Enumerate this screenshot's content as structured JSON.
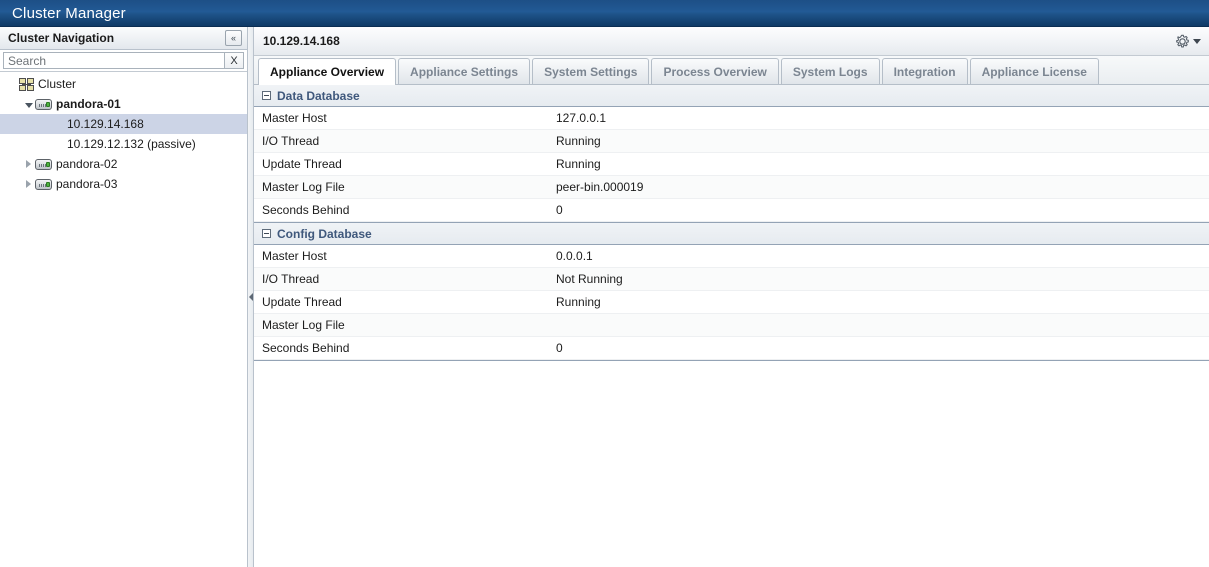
{
  "app": {
    "title": "Cluster Manager",
    "titlebar_color": "#1e5288"
  },
  "sidebar": {
    "header_title": "Cluster Navigation",
    "collapse_icon": "double-chevron-left-icon",
    "collapse_label": "«",
    "search": {
      "placeholder": "Search",
      "value": "",
      "clear_label": "X"
    },
    "tree": [
      {
        "label": "Cluster",
        "icon": "cluster-icon",
        "indent": 0,
        "twisty": "none",
        "bold": false,
        "selected": false
      },
      {
        "label": "pandora-01",
        "icon": "server-icon",
        "indent": 1,
        "twisty": "expanded",
        "bold": true,
        "selected": false
      },
      {
        "label": "10.129.14.168",
        "icon": "none",
        "indent": 3,
        "twisty": "none",
        "bold": false,
        "selected": true
      },
      {
        "label": "10.129.12.132 (passive)",
        "icon": "none",
        "indent": 3,
        "twisty": "none",
        "bold": false,
        "selected": false
      },
      {
        "label": "pandora-02",
        "icon": "server-icon",
        "indent": 1,
        "twisty": "collapsed",
        "bold": false,
        "selected": false
      },
      {
        "label": "pandora-03",
        "icon": "server-icon",
        "indent": 1,
        "twisty": "collapsed",
        "bold": false,
        "selected": false
      }
    ]
  },
  "content": {
    "host_title": "10.129.14.168",
    "gear_icon": "gear-icon",
    "dropdown_icon": "chevron-down-icon",
    "tabs": [
      {
        "label": "Appliance Overview",
        "active": true
      },
      {
        "label": "Appliance Settings",
        "active": false
      },
      {
        "label": "System Settings",
        "active": false
      },
      {
        "label": "Process Overview",
        "active": false
      },
      {
        "label": "System Logs",
        "active": false
      },
      {
        "label": "Integration",
        "active": false
      },
      {
        "label": "Appliance License",
        "active": false
      }
    ],
    "sections": [
      {
        "title": "Data Database",
        "collapsed": false,
        "rows": [
          {
            "label": "Master Host",
            "value": "127.0.0.1"
          },
          {
            "label": "I/O Thread",
            "value": "Running"
          },
          {
            "label": "Update Thread",
            "value": "Running"
          },
          {
            "label": "Master Log File",
            "value": "peer-bin.000019"
          },
          {
            "label": "Seconds Behind",
            "value": "0"
          }
        ]
      },
      {
        "title": "Config Database",
        "collapsed": false,
        "rows": [
          {
            "label": "Master Host",
            "value": "0.0.0.1"
          },
          {
            "label": "I/O Thread",
            "value": "Not Running"
          },
          {
            "label": "Update Thread",
            "value": "Running"
          },
          {
            "label": "Master Log File",
            "value": ""
          },
          {
            "label": "Seconds Behind",
            "value": "0"
          }
        ]
      }
    ]
  },
  "splitter": {
    "grip_icon": "collapse-left-arrow-icon"
  }
}
